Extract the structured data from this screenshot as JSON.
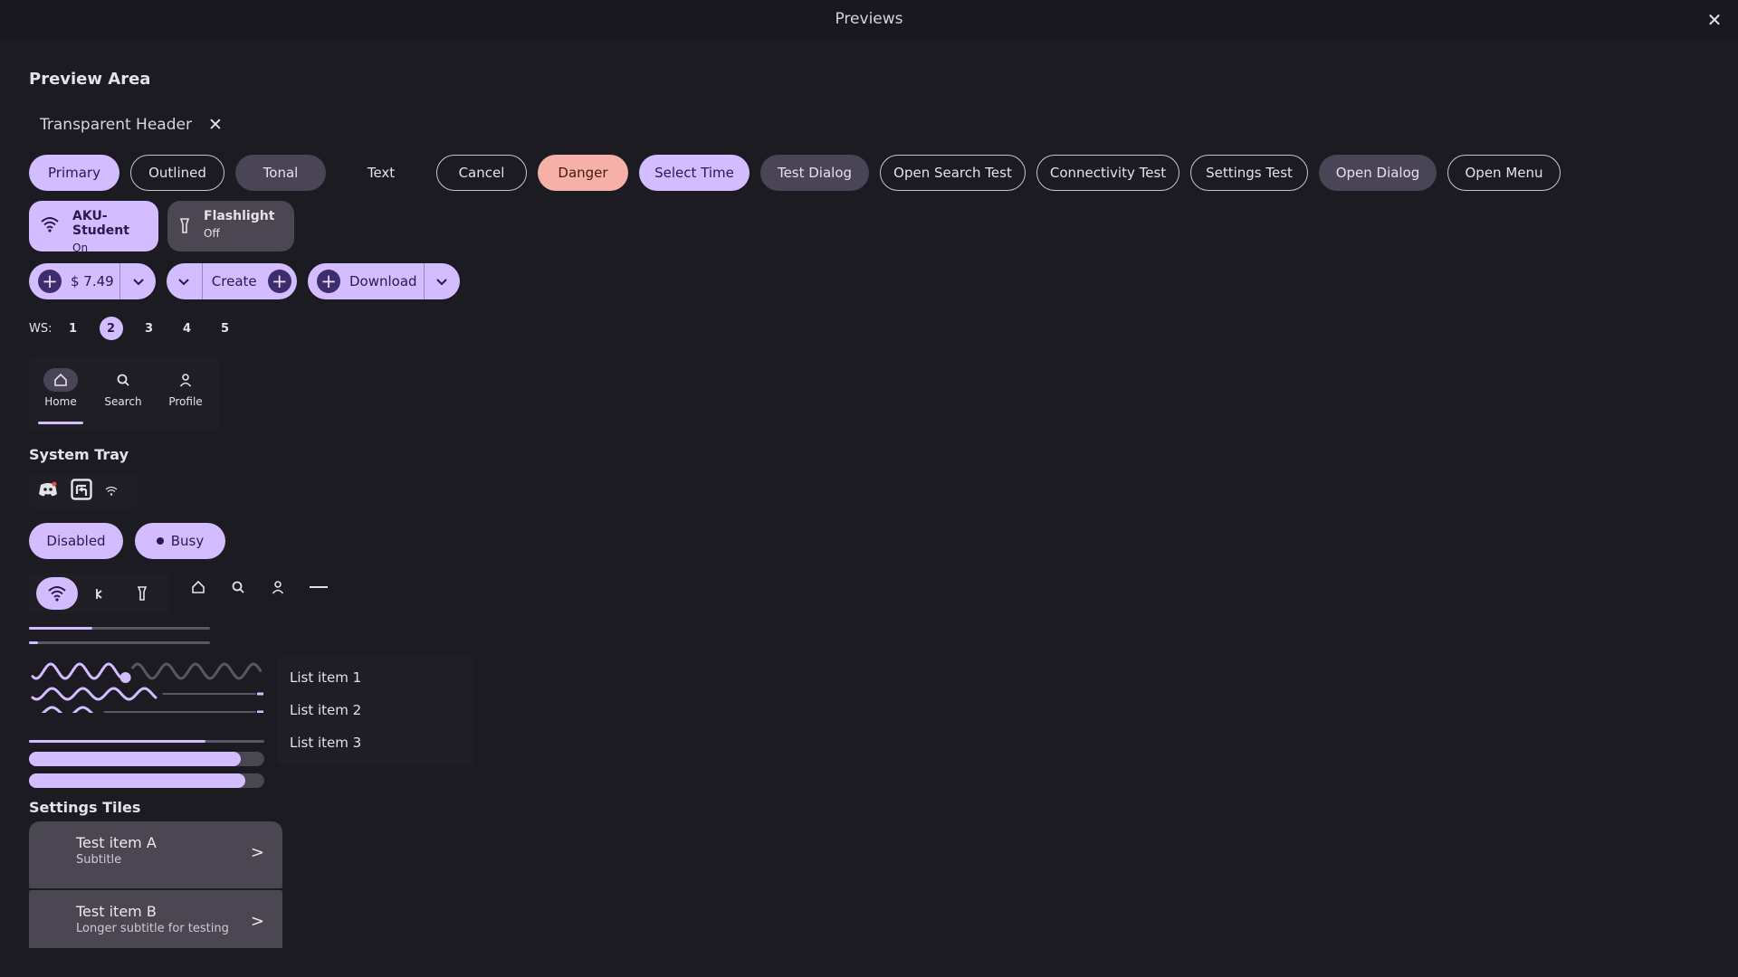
{
  "window": {
    "title": "Previews",
    "close_label": "✕"
  },
  "preview_area": {
    "title": "Preview Area"
  },
  "transparent_header": {
    "label": "Transparent Header",
    "close_label": "✕"
  },
  "buttons": [
    {
      "label": "Primary"
    },
    {
      "label": "Outlined"
    },
    {
      "label": "Tonal"
    },
    {
      "label": "Text"
    },
    {
      "label": "Cancel"
    },
    {
      "label": "Danger"
    },
    {
      "label": "Select Time"
    },
    {
      "label": "Test Dialog"
    },
    {
      "label": "Open Search Test"
    },
    {
      "label": "Connectivity Test"
    },
    {
      "label": "Settings Test"
    },
    {
      "label": "Open Dialog"
    },
    {
      "label": "Open Menu"
    }
  ],
  "quick_tiles": [
    {
      "title": "AKU-Student",
      "status": "On",
      "icon": "wifi-icon"
    },
    {
      "title": "Flashlight",
      "status": "Off",
      "icon": "flashlight-icon"
    }
  ],
  "split_buttons": {
    "price": "$ 7.49",
    "create": "Create",
    "download": "Download"
  },
  "workspaces": {
    "label": "WS:",
    "items": [
      "1",
      "2",
      "3",
      "4",
      "5"
    ],
    "active": "2"
  },
  "nav_bar": {
    "items": [
      {
        "label": "Home",
        "icon": "home-icon"
      },
      {
        "label": "Search",
        "icon": "search-icon"
      },
      {
        "label": "Profile",
        "icon": "profile-icon"
      }
    ],
    "active": "Home"
  },
  "system_tray": {
    "title": "System Tray",
    "icons": [
      "discord-icon",
      "app-switch-icon",
      "wifi-icon"
    ]
  },
  "state_buttons": {
    "disabled": "Disabled",
    "busy": "Busy"
  },
  "progress": {
    "bar1": 0.35,
    "bar2": 0.05,
    "wavy1": 0.41,
    "wavy2": 0.54,
    "wavy3": 0.29,
    "thin": 0.75,
    "thick1": 0.9,
    "thick2": 0.92
  },
  "list": {
    "items": [
      "List item 1",
      "List item 2",
      "List item 3"
    ]
  },
  "settings_tiles": {
    "title": "Settings Tiles",
    "items": [
      {
        "title": "Test item A",
        "subtitle": "Subtitle"
      },
      {
        "title": "Test item B",
        "subtitle": "Longer subtitle for testing"
      }
    ]
  },
  "colors": {
    "accent": "#d3bcff",
    "background": "#1c1b22",
    "tonal": "#4a4556",
    "danger": "#f6b0a8"
  }
}
